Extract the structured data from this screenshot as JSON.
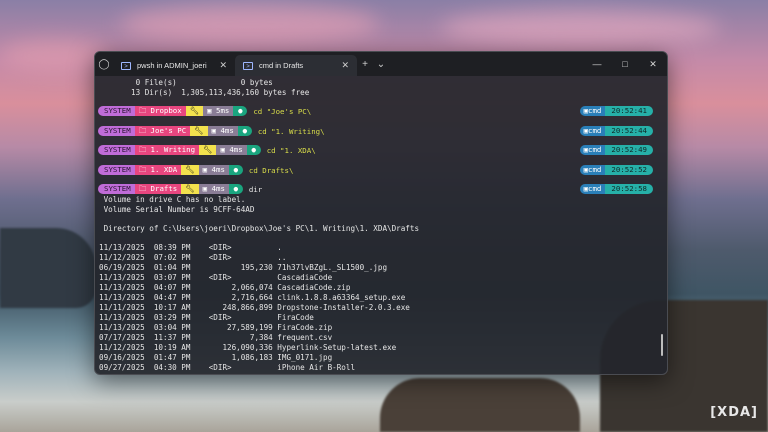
{
  "window": {
    "tabs": [
      {
        "label": "pwsh in ADMIN_joeri",
        "active": false
      },
      {
        "label": "cmd in Drafts",
        "active": true
      }
    ]
  },
  "console": {
    "summary": [
      "        0 File(s)              0 bytes",
      "       13 Dir(s)  1,305,113,436,160 bytes free"
    ],
    "prompts": [
      {
        "user": "SYSTEM",
        "dir": "Dropbox",
        "duration": "5ms",
        "command": "cd \"Joe's PC\\",
        "shell": "cmd",
        "time": "20:52:41"
      },
      {
        "user": "SYSTEM",
        "dir": "Joe's PC",
        "duration": "4ms",
        "command": "cd \"1. Writing\\",
        "shell": "cmd",
        "time": "20:52:44"
      },
      {
        "user": "SYSTEM",
        "dir": "1. Writing",
        "duration": "4ms",
        "command": "cd \"1. XDA\\",
        "shell": "cmd",
        "time": "20:52:49"
      },
      {
        "user": "SYSTEM",
        "dir": "1. XDA",
        "duration": "4ms",
        "command": "cd Drafts\\",
        "shell": "cmd",
        "time": "20:52:52"
      },
      {
        "user": "SYSTEM",
        "dir": "Drafts",
        "duration": "4ms",
        "command": "dir",
        "shell": "cmd",
        "time": "20:52:58"
      }
    ],
    "volume_label": " Volume in drive C has no label.",
    "volume_serial": " Volume Serial Number is 9CFF-64AD",
    "directory_of": " Directory of C:\\Users\\joeri\\Dropbox\\Joe's PC\\1. Writing\\1. XDA\\Drafts",
    "listing": [
      "11/13/2025  08:39 PM    <DIR>          .",
      "11/12/2025  07:02 PM    <DIR>          ..",
      "06/19/2025  01:04 PM           195,230 71h37lvBZgL._SL1500_.jpg",
      "11/13/2025  03:07 PM    <DIR>          CascadiaCode",
      "11/13/2025  04:07 PM         2,066,074 CascadiaCode.zip",
      "11/13/2025  04:47 PM         2,716,664 clink.1.8.8.a63364_setup.exe",
      "11/11/2025  10:17 AM       248,866,899 Dropstone-Installer-2.0.3.exe",
      "11/13/2025  03:29 PM    <DIR>          FiraCode",
      "11/13/2025  03:04 PM        27,589,199 FiraCode.zip",
      "07/17/2025  11:37 PM             7,384 frequent.csv",
      "11/12/2025  10:19 AM       126,090,336 Hyperlink-Setup-latest.exe",
      "09/16/2025  01:47 PM         1,086,183 IMG_0171.jpg",
      "09/27/2025  04:30 PM    <DIR>          iPhone Air B-Roll"
    ]
  },
  "watermark": "XDA",
  "colors": {
    "segment_system": "#c06cd8",
    "segment_dir": "#e8467f",
    "segment_git": "#f3e24d",
    "segment_duration": "#8a7d96",
    "segment_status": "#1aa57f",
    "shell_badge": "#2a7fb8",
    "clock_badge": "#26b0a8",
    "command_text": "#d9dd4a"
  }
}
